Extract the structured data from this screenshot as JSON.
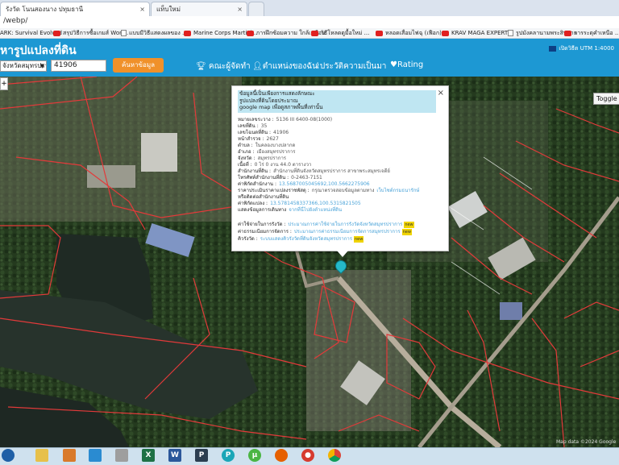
{
  "browser": {
    "tabs": [
      {
        "label": "รังวัด โนนสองนาง ปทุมธานี"
      },
      {
        "label": "แท็บใหม่"
      }
    ],
    "address": "/webp/",
    "bookmarks": [
      "ARK: Survival Evolved",
      "สรุปวิธีการซื้อเกมส์ Won...",
      "แบบมีวิธีแสดงผลของ ...",
      "Marine Corps Martial...",
      "การฝึกซ้อมความ ใกล้เหมือน",
      "วิธีโหลดดูมื้อใหม่ ...",
      "หลอดเสื่อมไฟฉุ (เฟือก)",
      "KRAV MAGA EXPERT",
      "รูปมังคลานามพระสิทธาร",
      "การระดุคำเหนือ ..."
    ]
  },
  "app": {
    "title": "หารูปแปลงที่ดิน",
    "utm_label": "เปิดวิธีต UTM 1:4000",
    "province_select": "จังหวัดสมุทรปราการ",
    "parcel_input": "41906",
    "search_button": "ค้นหาข้อมูล",
    "nav": [
      {
        "icon": "trophy-icon",
        "label": "คณะผู้จัดทำ"
      },
      {
        "icon": "person-icon",
        "label": "ตำแหน่งของฉัน"
      },
      {
        "icon": "history-icon",
        "label": "ประวัติความเป็นมา"
      },
      {
        "icon": "heart-icon",
        "label": "Rating"
      }
    ]
  },
  "map": {
    "toggle_label": "Toggle Street",
    "zoom_label": "+",
    "attribution": "Map data ©2024 Google",
    "popup": {
      "warning_lines": [
        "ข้อมูลนี้เป็นเพียงการแสดงลักษณะ",
        "รูปแปลงที่ดินโดยประมาณ",
        "google map เพื่อดูสภาพพื้นที่เท่านั้น"
      ],
      "close": "×",
      "rows": [
        {
          "label": "หมายเลขระวาง :",
          "value": "5136 III 6400-08(1000)"
        },
        {
          "label": "เลขที่ดิน :",
          "value": "35"
        },
        {
          "label": "เลขโฉนดที่ดิน :",
          "value": "41906"
        },
        {
          "label": "หน้าสำรวจ :",
          "value": "2627"
        },
        {
          "label": "ตำบล :",
          "value": "ในคลองบางปลากด"
        },
        {
          "label": "อำเภอ :",
          "value": "เมืองสมุทรปราการ"
        },
        {
          "label": "จังหวัด :",
          "value": "สมุทรปราการ"
        },
        {
          "label": "เนื้อที่ :",
          "value": "0 ไร่ 0 งาน 44.0 ตารางวา"
        },
        {
          "label": "สำนักงานที่ดิน :",
          "value": "สำนักงานที่ดินจังหวัดสมุทรปราการ สาขาพระสมุทรเจดีย์"
        },
        {
          "label": "โทรศัพท์สำนักงานที่ดิน :",
          "value": "0-2463-7151"
        },
        {
          "label": "ค่าพิกัดสำนักงาน :",
          "link": "13.5687005045692,100.5662275906"
        },
        {
          "label": "ราคาประเมินราคาแปลงราชพัสดุ :",
          "value": "กรุณาตรวจสอบข้อมูลตามทาง",
          "link": "เว็บไซต์กรมธนารักษ์"
        },
        {
          "label": "หรือติดต่อสำนักงานที่ดิน",
          "value": ""
        },
        {
          "label": "ค่าพิกัดแปลง :",
          "link": "13.5781458337366,100.5315821505"
        },
        {
          "label": "แสดงข้อมูลการเดินทาง",
          "link": "จากที่นี่ไปยังตำแหน่งที่ดิน"
        },
        {
          "label": "ค่าใช้จ่ายในการรังวัด :",
          "link": "ประมาณการค่าใช้จ่ายในการรังวัดจังหวัดสมุทรปราการ",
          "badge": "new"
        },
        {
          "label": "ค่าธรรมเนียมการจัดการ :",
          "link": "ประมาณการค่าธรรมเนียมการจัดการสมุทรปราการ",
          "badge": "new"
        },
        {
          "label": "คิวรังวัด :",
          "link": "ระบบแสดงคิวรังวัดที่ดินจังหวัดสมุทรปราการ",
          "badge": "new"
        }
      ]
    }
  },
  "taskbar": {
    "apps": [
      {
        "icon": "start-icon",
        "glyph": ""
      },
      {
        "icon": "explorer-icon",
        "glyph": ""
      },
      {
        "icon": "media-icon",
        "glyph": ""
      },
      {
        "icon": "chrome-old-icon",
        "glyph": ""
      },
      {
        "icon": "excel-icon",
        "glyph": "X"
      },
      {
        "icon": "word-icon",
        "glyph": "W"
      },
      {
        "icon": "app-icon",
        "glyph": "P"
      },
      {
        "icon": "picsart-icon",
        "glyph": "P"
      },
      {
        "icon": "torrent-icon",
        "glyph": "µ"
      },
      {
        "icon": "firefox-icon",
        "glyph": ""
      },
      {
        "icon": "record-icon",
        "glyph": "●"
      },
      {
        "icon": "chrome-icon",
        "glyph": ""
      }
    ]
  }
}
